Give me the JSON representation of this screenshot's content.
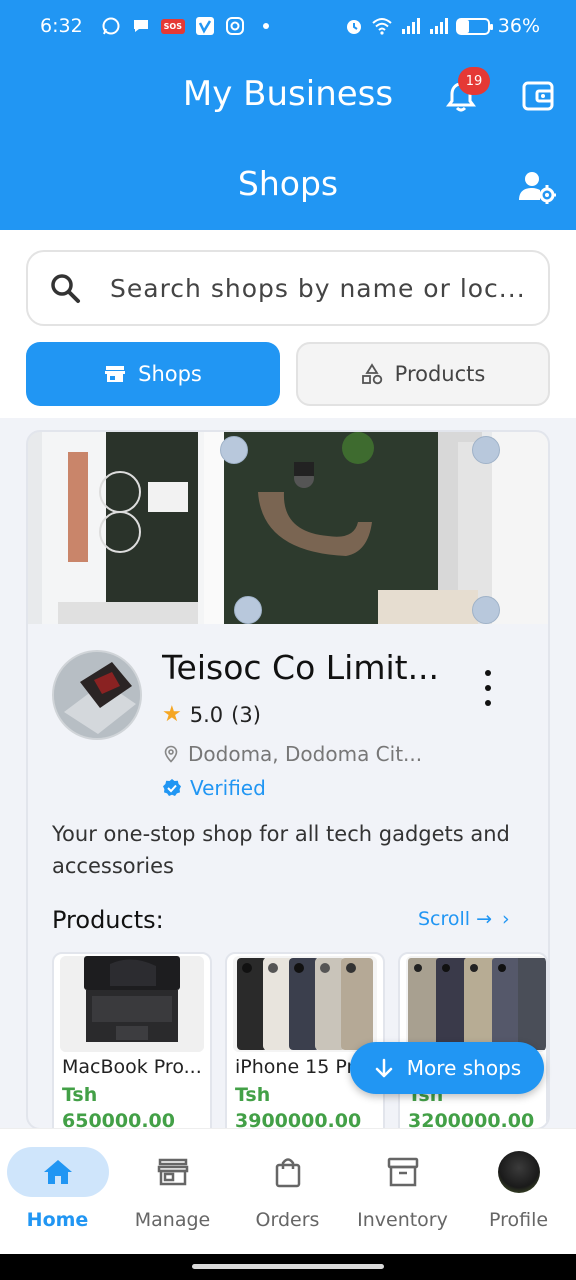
{
  "status_bar": {
    "time": "6:32",
    "battery": "36%",
    "battery_level": 0.36,
    "sos": "SOS"
  },
  "header": {
    "title": "My Business",
    "notification_count": "19",
    "page_title": "Shops"
  },
  "search": {
    "placeholder": "Search shops by name or loc..."
  },
  "tabs": {
    "shops": "Shops",
    "products": "Products"
  },
  "shop": {
    "name": "Teisoc Co Limit...",
    "rating": "5.0",
    "rating_count": "(3)",
    "location": "Dodoma, Dodoma Cit...",
    "verified": "Verified",
    "description": "Your one-stop shop for all tech gadgets and accessories",
    "products_label": "Products:",
    "scroll_label": "Scroll →",
    "products": [
      {
        "name": "MacBook Pro...",
        "currency": "Tsh",
        "price": "650000.00"
      },
      {
        "name": "iPhone 15 Pr",
        "currency": "Tsh",
        "price": "3900000.00"
      },
      {
        "name": "",
        "currency": "Tsh",
        "price": "3200000.00"
      }
    ]
  },
  "fab": {
    "label": "More shops"
  },
  "nav": {
    "home": "Home",
    "manage": "Manage",
    "orders": "Orders",
    "inventory": "Inventory",
    "profile": "Profile"
  },
  "colors": {
    "primary": "#2196F3",
    "price_green": "#43A047",
    "badge_red": "#E53935",
    "star": "#F5A623"
  }
}
